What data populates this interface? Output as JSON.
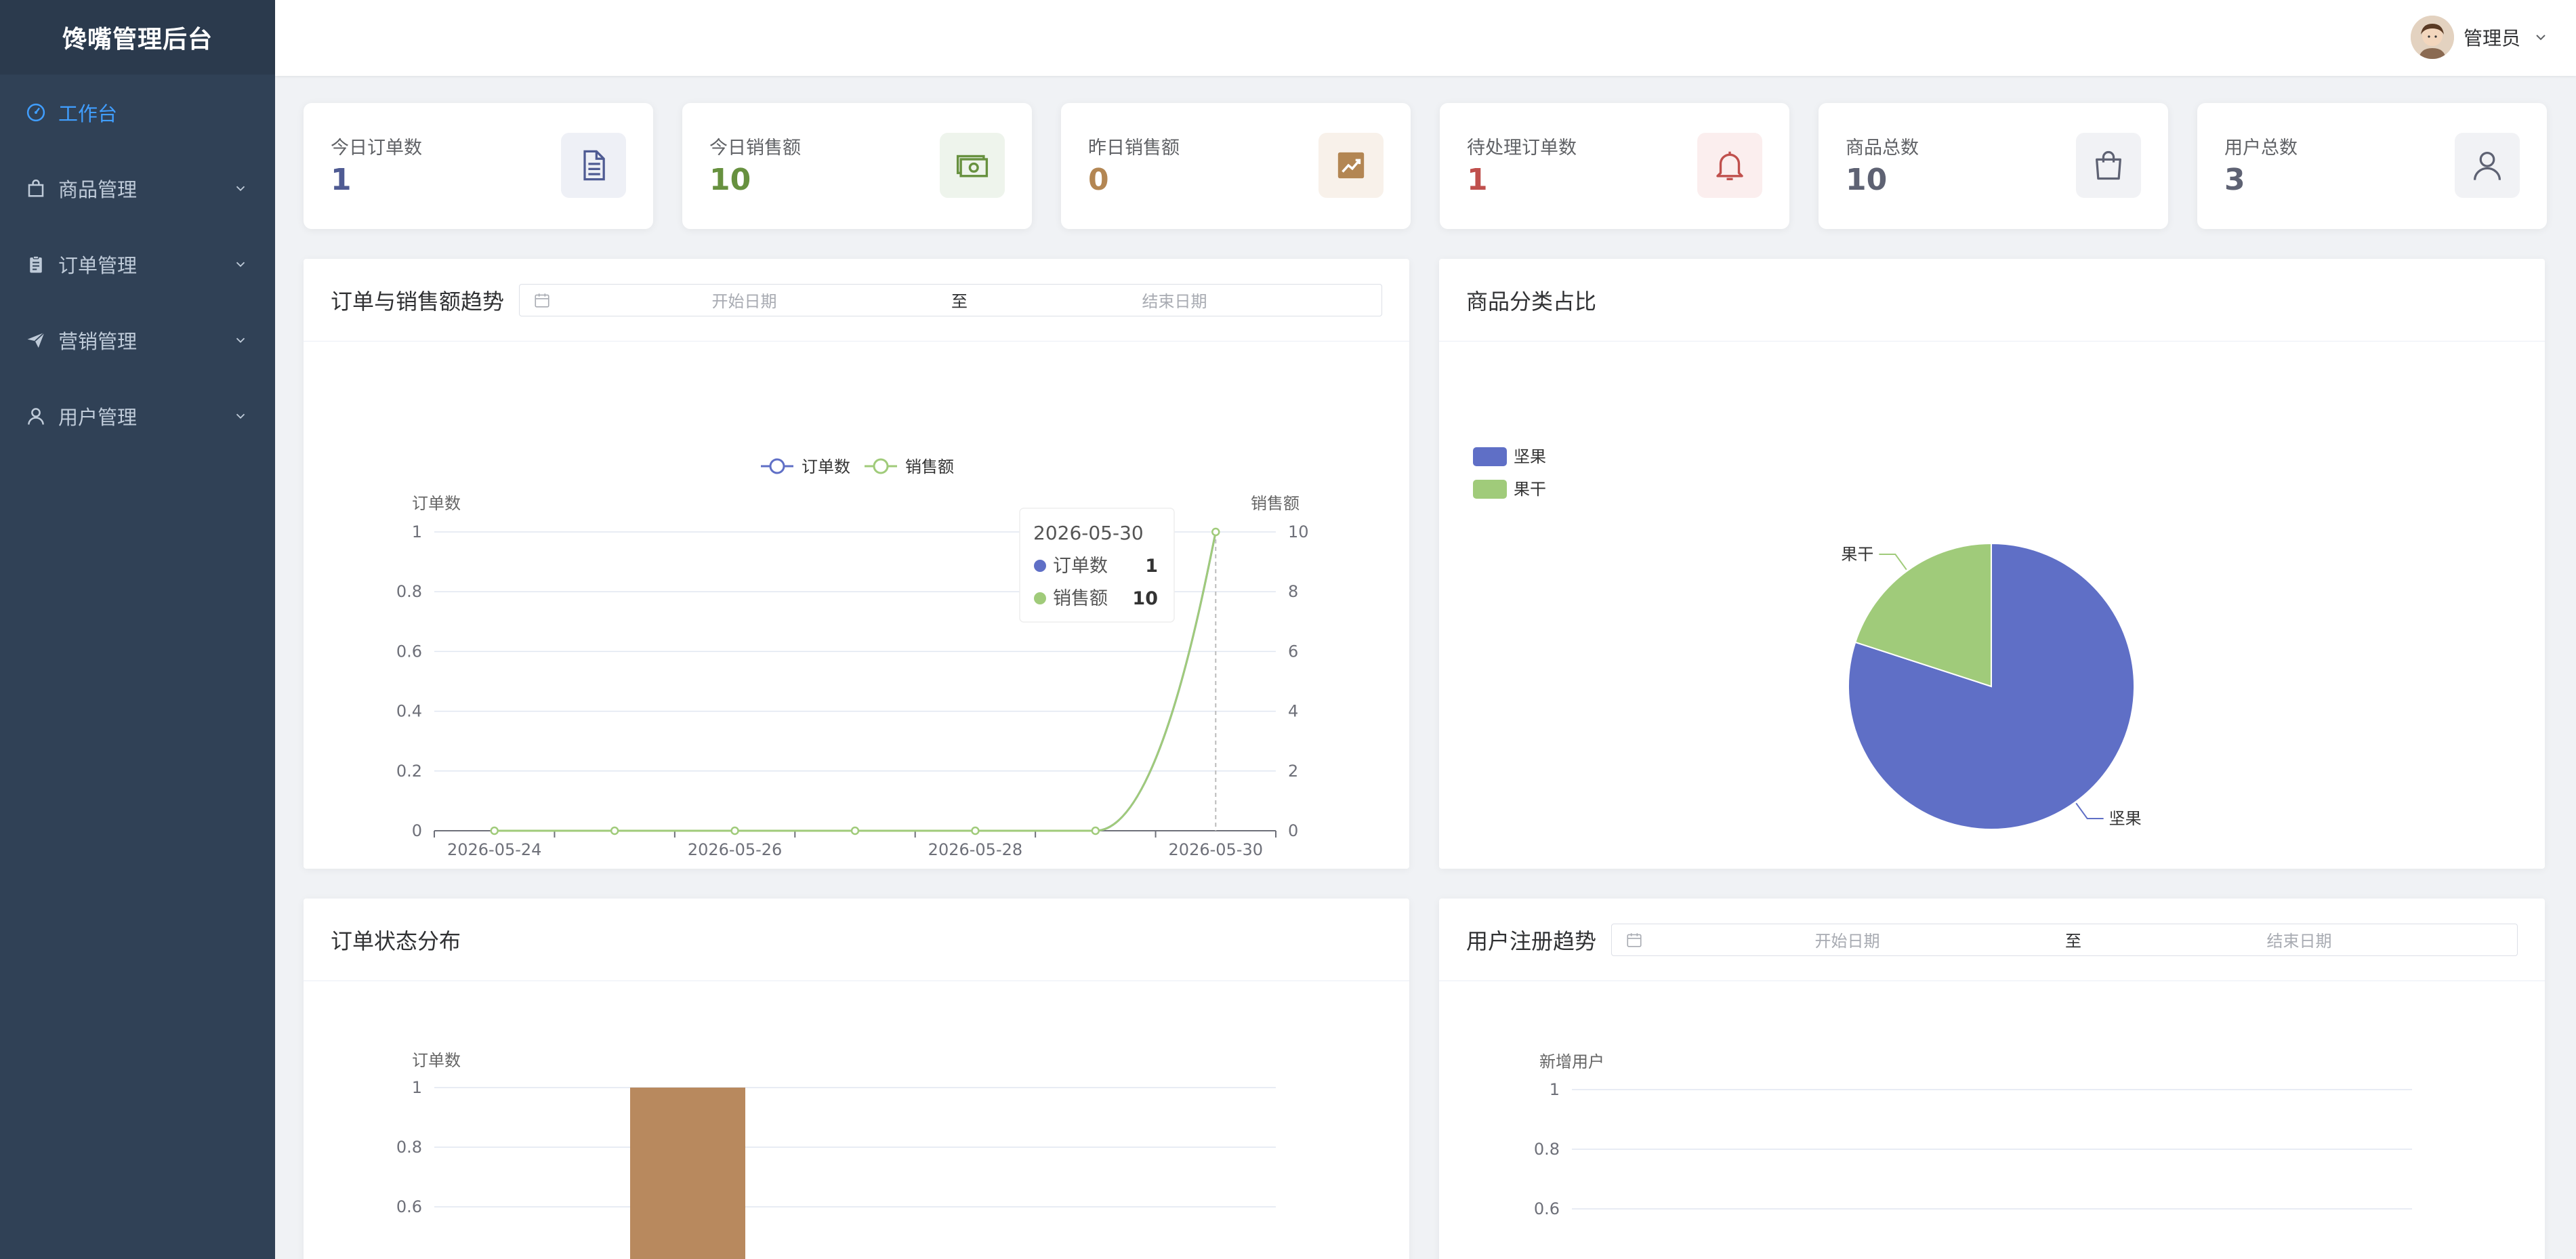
{
  "sidebar": {
    "brand": "馋嘴管理后台",
    "items": [
      {
        "label": "工作台",
        "active": true
      },
      {
        "label": "商品管理"
      },
      {
        "label": "订单管理"
      },
      {
        "label": "营销管理"
      },
      {
        "label": "用户管理"
      }
    ]
  },
  "header": {
    "user_name": "管理员"
  },
  "stats": [
    {
      "label": "今日订单数",
      "value": "1",
      "color": "#4f5b93",
      "icon": "document-icon",
      "bg": "#eef0f6"
    },
    {
      "label": "今日销售额",
      "value": "10",
      "color": "#67913f",
      "icon": "cash-icon",
      "bg": "#eef4ec"
    },
    {
      "label": "昨日销售额",
      "value": "0",
      "color": "#b38653",
      "icon": "trend-icon",
      "bg": "#f8f1ea"
    },
    {
      "label": "待处理订单数",
      "value": "1",
      "color": "#c0504d",
      "icon": "bell-icon",
      "bg": "#fbeeee"
    },
    {
      "label": "商品总数",
      "value": "10",
      "color": "#5e6273",
      "icon": "bag-icon",
      "bg": "#f1f2f5"
    },
    {
      "label": "用户总数",
      "value": "3",
      "color": "#5e6273",
      "icon": "user-icon",
      "bg": "#f1f2f5"
    }
  ],
  "panels": {
    "trend": {
      "title": "订单与销售额趋势",
      "start_placeholder": "开始日期",
      "separator": "至",
      "end_placeholder": "结束日期"
    },
    "category": {
      "title": "商品分类占比"
    },
    "status": {
      "title": "订单状态分布"
    },
    "register": {
      "title": "用户注册趋势",
      "start_placeholder": "开始日期",
      "separator": "至",
      "end_placeholder": "结束日期"
    }
  },
  "colors": {
    "blue": "#5f6fc6",
    "green": "#a0cb7a",
    "brown": "#b8895e"
  },
  "chart_data": [
    {
      "type": "line",
      "x": [
        "2026-05-24",
        "2026-05-25",
        "2026-05-26",
        "2026-05-27",
        "2026-05-28",
        "2026-05-29",
        "2026-05-30"
      ],
      "xticks": [
        "2026-05-24",
        "2026-05-26",
        "2026-05-28",
        "2026-05-30"
      ],
      "series": [
        {
          "name": "订单数",
          "axis": "left",
          "values": [
            0,
            0,
            0,
            0,
            0,
            0,
            1
          ]
        },
        {
          "name": "销售额",
          "axis": "right",
          "values": [
            0,
            0,
            0,
            0,
            0,
            0,
            10
          ]
        }
      ],
      "ylabel": "订单数",
      "y2label": "销售额",
      "ylim": [
        0,
        1
      ],
      "y2lim": [
        0,
        10
      ],
      "yticks": [
        "0",
        "0.2",
        "0.4",
        "0.6",
        "0.8",
        "1"
      ],
      "y2ticks": [
        "0",
        "2",
        "4",
        "6",
        "8",
        "10"
      ],
      "legend": "top-center",
      "grid": true,
      "tooltip": {
        "date": "2026-05-30",
        "rows": [
          {
            "name": "订单数",
            "value": "1"
          },
          {
            "name": "销售额",
            "value": "10"
          }
        ]
      }
    },
    {
      "type": "pie",
      "slices": [
        {
          "name": "坚果",
          "value": 8
        },
        {
          "name": "果干",
          "value": 2
        }
      ],
      "legend": "top-left"
    },
    {
      "type": "bar",
      "ylabel": "订单数",
      "values": [
        1
      ],
      "ylim": [
        0,
        1
      ],
      "yticks": [
        "0.6",
        "0.8",
        "1"
      ]
    },
    {
      "type": "line",
      "ylabel": "新增用户",
      "ylim": [
        0,
        1
      ],
      "yticks": [
        "0.6",
        "0.8",
        "1"
      ]
    }
  ]
}
